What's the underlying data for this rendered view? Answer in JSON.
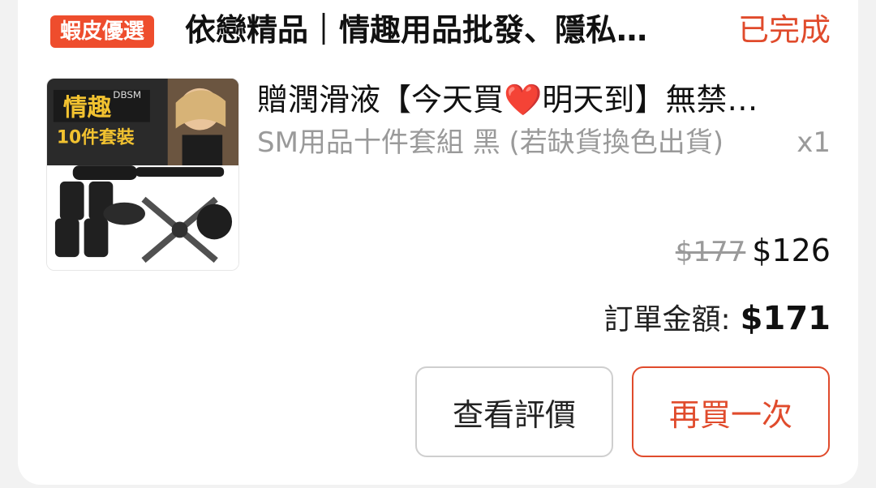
{
  "order": {
    "badge": "蝦皮優選",
    "shop_name": "依戀精品｜情趣用品批發、隱私…",
    "status": "已完成",
    "product": {
      "title": "贈潤滑液【今天買❤️明天到】無禁…",
      "variation": "SM用品十件套組 黑 (若缺貨換色出貨)",
      "quantity": "x1",
      "original_price": "$177",
      "price": "$126",
      "image": {
        "caption_main": "情趣",
        "caption_sub": "10件套裝",
        "brand": "DBSM"
      }
    },
    "total_label": "訂單金額:",
    "total_value": "$171",
    "buttons": {
      "review": "查看評價",
      "rebuy": "再買一次"
    }
  },
  "colors": {
    "accent": "#ee4d2d",
    "status": "#e04b2c",
    "muted": "#9a9a9a"
  }
}
